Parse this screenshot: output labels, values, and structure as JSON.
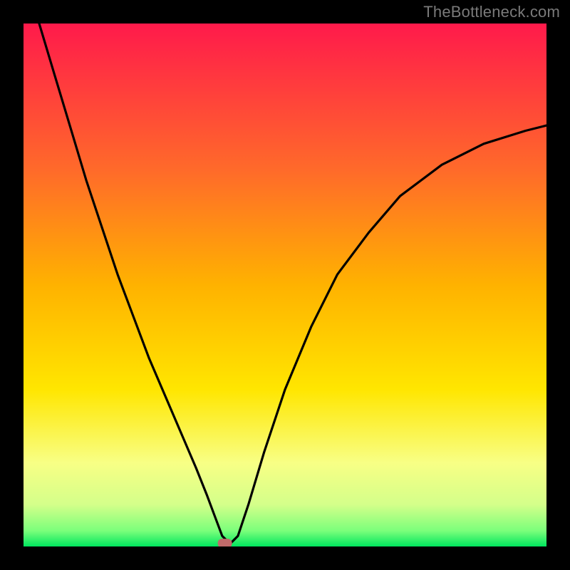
{
  "attribution": "TheBottleneck.com",
  "chart_data": {
    "type": "line",
    "title": "",
    "xlabel": "",
    "ylabel": "",
    "xlim": [
      0,
      100
    ],
    "ylim": [
      0,
      100
    ],
    "background_gradient": {
      "top": "#ff1a4b",
      "upper_mid": "#ffa500",
      "mid": "#ffff00",
      "lower": "#f7ff9e",
      "bottom": "#00e65e"
    },
    "curve_color": "#000000",
    "marker": {
      "x": 38.5,
      "y": 0.6,
      "color": "#c06a6a",
      "shape": "rounded-rect"
    },
    "series": [
      {
        "name": "bottleneck-curve",
        "x": [
          3,
          6,
          9,
          12,
          15,
          18,
          21,
          24,
          27,
          30,
          33,
          35,
          36.5,
          38,
          39.5,
          41,
          43,
          46,
          50,
          55,
          60,
          66,
          72,
          80,
          88,
          96,
          100
        ],
        "y": [
          100,
          90,
          80,
          70,
          61,
          52,
          44,
          36,
          29,
          22,
          15,
          10,
          6,
          2,
          0.5,
          2,
          8,
          18,
          30,
          42,
          52,
          60,
          67,
          73,
          77,
          79.5,
          80.5
        ]
      }
    ]
  }
}
